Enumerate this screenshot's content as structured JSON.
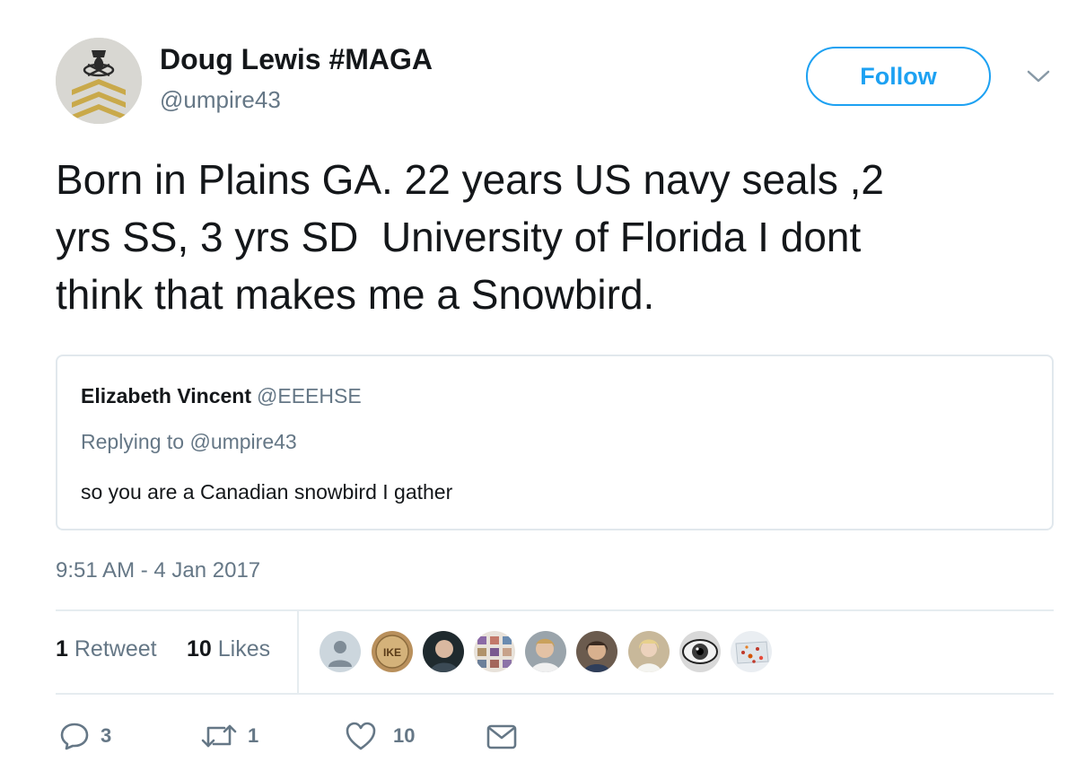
{
  "author": {
    "name": "Doug Lewis #MAGA",
    "handle": "@umpire43",
    "avatar_icon": "navy-rank-insignia-avatar"
  },
  "follow_label": "Follow",
  "menu_icon": "chevron-down-icon",
  "tweet_lines": [
    "Born in Plains GA. 22 years US navy seals ,2",
    "yrs SS, 3 yrs SD  University of Florida I dont",
    "think that makes me a Snowbird."
  ],
  "quoted": {
    "name": "Elizabeth Vincent",
    "handle": "@EEEHSE",
    "replying_prefix": "Replying to",
    "replying_to": "@umpire43",
    "text": "so you are a Canadian snowbird I gather"
  },
  "timestamp": "9:51 AM - 4 Jan 2017",
  "stats": {
    "retweets_count": "1",
    "retweets_label": "Retweet",
    "likes_count": "10",
    "likes_label": "Likes"
  },
  "actions": {
    "reply_count": "3",
    "retweet_count": "1",
    "like_count": "10"
  },
  "badge_text": "IKE",
  "colors": {
    "accent": "#1da1f2",
    "text": "#14171a",
    "secondary": "#657786",
    "border": "#e1e8ed"
  }
}
